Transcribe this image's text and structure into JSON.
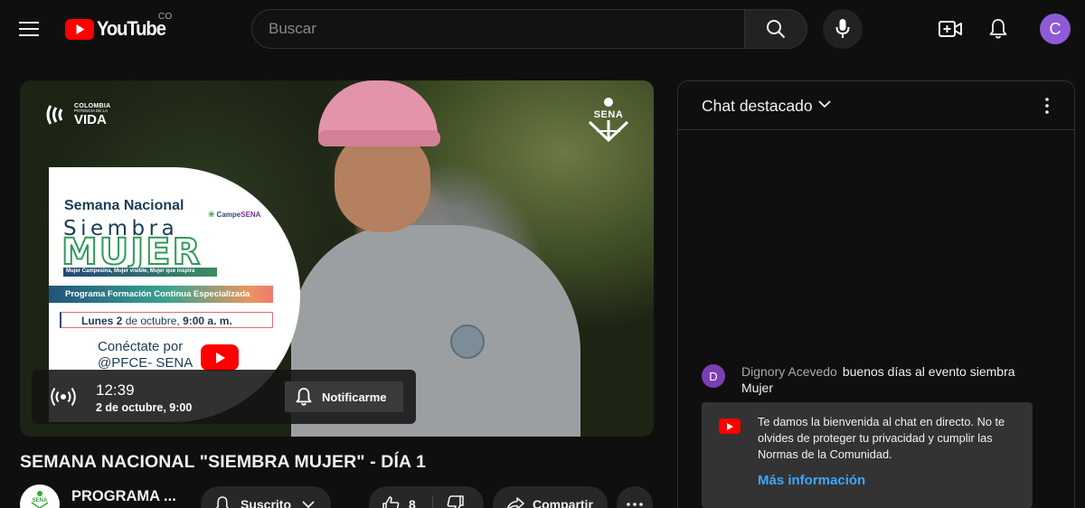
{
  "header": {
    "logo_text": "YouTube",
    "country_code": "CO",
    "search_placeholder": "Buscar",
    "avatar_letter": "C",
    "avatar_color": "#8e5bd6"
  },
  "video": {
    "overlay": {
      "colombia_small": "COLOMBIA",
      "colombia_sub": "POTENCIA DE LA",
      "colombia_big": "VIDA",
      "sena": "SENA"
    },
    "poster": {
      "title": "Semana Nacional",
      "siembra": "Siembra",
      "mujer": "MUJER",
      "tagline": "Mujer Campesina, Mujer visible, Mujer que inspira",
      "campe_prefix": "Campe",
      "campe_suffix": "SENA",
      "program": "Programa Formación Continua Especializada",
      "date_day": "Lunes 2",
      "date_mid": " de octubre, ",
      "date_time": "9:00 a. m.",
      "connect_line1": "Conéctate por",
      "connect_line2": "@PFCE- SENA"
    },
    "live": {
      "time": "12:39",
      "date": "2 de octubre, 9:00",
      "notify_label": "Notificarme"
    }
  },
  "video_info": {
    "title": "SEMANA NACIONAL \"SIEMBRA MUJER\" - DÍA 1",
    "channel_name": "PROGRAMA ...",
    "channel_avatar_text": "SENA",
    "subscribed_label": "Suscrito",
    "like_count": "8",
    "share_label": "Compartir"
  },
  "chat": {
    "title": "Chat destacado",
    "messages": [
      {
        "avatar_letter": "D",
        "author": "Dignory Acevedo",
        "text": "buenos días al evento siembra Mujer"
      }
    ],
    "welcome": {
      "text": "Te damos la bienvenida al chat en directo. No te olvides de proteger tu privacidad y cumplir las Normas de la Comunidad.",
      "link": "Más información"
    }
  },
  "colors": {
    "background": "#0f0f0f",
    "youtube_red": "#ff0000",
    "link_blue": "#3ea6ff",
    "button_bg": "#272727"
  }
}
